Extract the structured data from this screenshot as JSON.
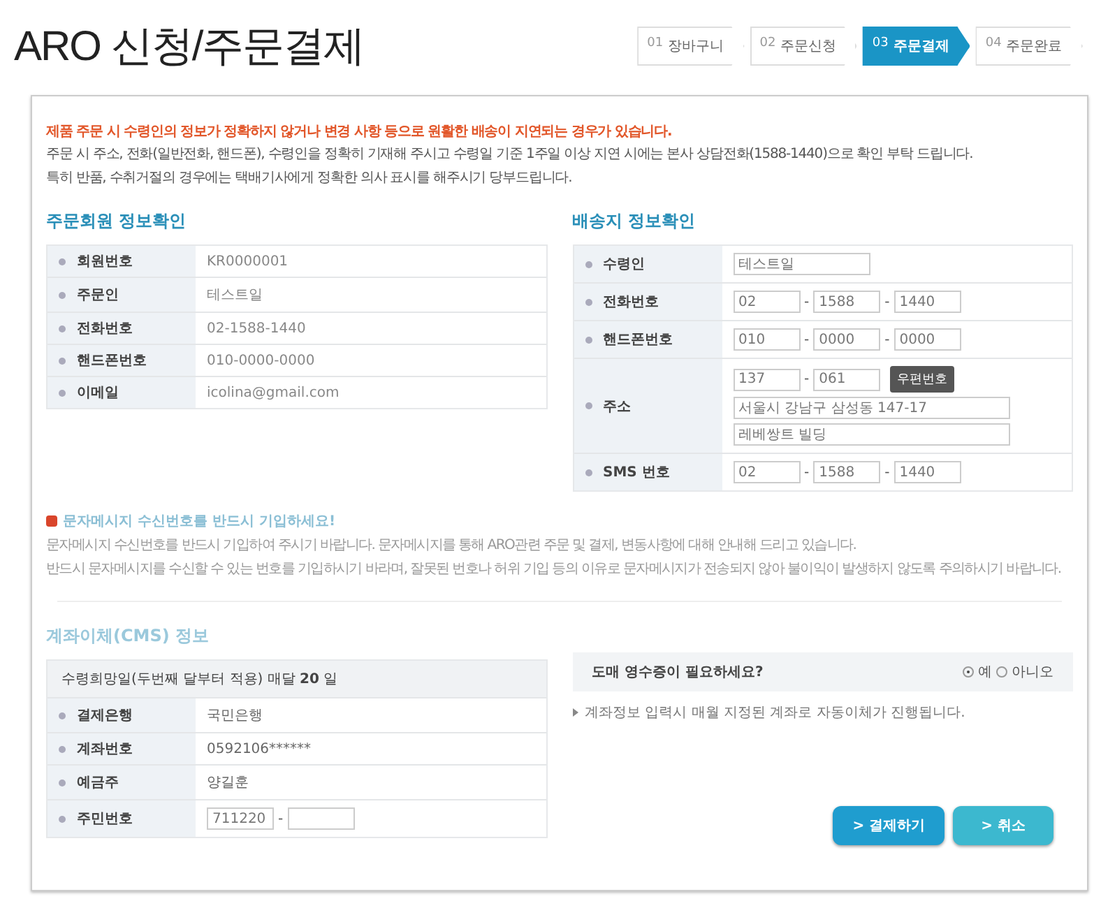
{
  "page_title": "ARO 신청/주문결제",
  "steps": [
    {
      "number": "01",
      "label": "장바구니",
      "selected": false
    },
    {
      "number": "02",
      "label": "주문신청",
      "selected": false
    },
    {
      "number": "03",
      "label": "주문결제",
      "selected": true
    },
    {
      "number": "04",
      "label": "주문완료",
      "selected": false
    }
  ],
  "notice": {
    "warning": "제품 주문 시 수령인의 정보가 정확하지 않거나 변경 사항 등으로 원활한 배송이 지연되는 경우가 있습니다.",
    "lines": [
      "주문 시 주소, 전화(일반전화, 핸드폰), 수령인을 정확히 기재해 주시고 수령일 기준 1주일 이상 지연 시에는 본사 상담전화(1588-1440)으로 확인 부탁 드립니다.",
      "특히 반품, 수취거절의 경우에는 택배기사에게 정확한 의사 표시를 해주시기 당부드립니다."
    ]
  },
  "member_info": {
    "title": "주문회원 정보확인",
    "rows": [
      {
        "label": "회원번호",
        "value": "KR0000001"
      },
      {
        "label": "주문인",
        "value": "테스트일"
      },
      {
        "label": "전화번호",
        "value": "02-1588-1440"
      },
      {
        "label": "핸드폰번호",
        "value": "010-0000-0000"
      },
      {
        "label": "이메일",
        "value": "icolina@gmail.com"
      }
    ]
  },
  "shipping_info": {
    "title": "배송지 정보확인",
    "separator": "-",
    "rows": [
      {
        "label": "수령인",
        "kind": "single",
        "fields": [
          "테스트일"
        ]
      },
      {
        "label": "전화번호",
        "kind": "phone",
        "fields": [
          "02",
          "1588",
          "1440"
        ]
      },
      {
        "label": "핸드폰번호",
        "kind": "phone",
        "fields": [
          "010",
          "0000",
          "0000"
        ]
      },
      {
        "label": "주소",
        "kind": "address",
        "fields": [
          "137",
          "061"
        ],
        "button": "우편번호",
        "lines": [
          "서울시 강남구 삼성동 147-17",
          "레베쌍트 빌딩"
        ]
      },
      {
        "label": "SMS 번호",
        "kind": "phone",
        "fields": [
          "02",
          "1588",
          "1440"
        ]
      }
    ]
  },
  "sms_notice": {
    "title": "문자메시지 수신번호를 반드시 기입하세요!",
    "lines": [
      "문자메시지 수신번호를 반드시 기입하여 주시기 바랍니다. 문자메시지를 통해 ARO관련 주문 및 결제, 변동사항에 대해 안내해 드리고 있습니다.",
      "반드시 문자메시지를 수신할 수 있는 번호를 기입하시기 바라며, 잘못된 번호나 허위 기입 등의 이유로 문자메시지가 전송되지 않아 불이익이 발생하지 않도록 주의하시기 바랍니다."
    ]
  },
  "cms_info": {
    "title": "계좌이체(CMS) 정보",
    "separator": "-",
    "header": "수령희망일(두번째 달부터 적용) 매달 **20** 일",
    "rows": [
      {
        "label": "결제은행",
        "kind": "text",
        "value": "국민은행"
      },
      {
        "label": "계좌번호",
        "kind": "text",
        "value": "0592106******"
      },
      {
        "label": "예금주",
        "kind": "text",
        "value": "양길훈"
      },
      {
        "label": "주민번호",
        "kind": "ssn",
        "value": "711220"
      }
    ]
  },
  "receipt": {
    "question": "도매 영수증이 필요하세요?",
    "options": [
      {
        "label": "예",
        "selected": true
      },
      {
        "label": "아니오",
        "selected": false
      }
    ],
    "note": "계좌정보 입력시 매월 지정된 계좌로 자동이체가 진행됩니다."
  },
  "buttons": [
    {
      "label": "> 결제하기"
    },
    {
      "label": "> 취소"
    }
  ]
}
